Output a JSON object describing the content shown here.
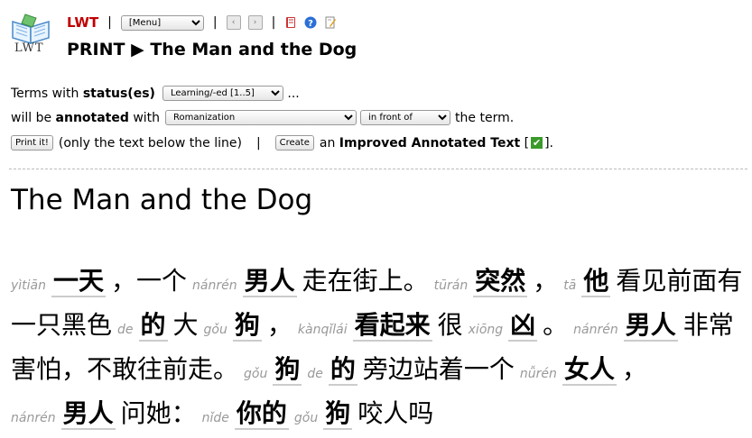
{
  "header": {
    "app_name": "LWT",
    "logo_text": "LWT",
    "menu_select": "[Menu]",
    "separator": "|",
    "page_title": "PRINT ▶ The Man and the Dog"
  },
  "options": {
    "line1_prefix": "Terms with ",
    "line1_bold": "status(es)",
    "status_select": "Learning/-ed [1..5]",
    "line1_suffix": " ...",
    "line2_prefix": "will be ",
    "line2_bold": "annotated",
    "line2_mid": " with",
    "annotation_select": "Romanization",
    "position_select": "in front of",
    "line2_suffix": "the term.",
    "print_button": "Print it!",
    "print_note": "(only the text below the line)",
    "sep": "|",
    "create_button": "Create",
    "improved_prefix": "an ",
    "improved_bold": "Improved Annotated Text",
    "improved_open": " [",
    "improved_close": "]."
  },
  "text": {
    "title": "The Man and the Dog",
    "segments": [
      {
        "rom": "yìtiān",
        "term": "一天"
      },
      {
        "plain": "，一个"
      },
      {
        "rom": "nánrén",
        "term": "男人"
      },
      {
        "plain": "走在街上。"
      },
      {
        "rom": "tūrán",
        "term": "突然"
      },
      {
        "plain": "，"
      },
      {
        "rom": "tā",
        "term": "他"
      },
      {
        "plain": "看见前面有一只黑色"
      },
      {
        "rom": "de",
        "term": "的"
      },
      {
        "plain": "大"
      },
      {
        "rom": "gǒu",
        "term": "狗"
      },
      {
        "plain": "，"
      },
      {
        "rom": "kànqǐlái",
        "term": "看起来"
      },
      {
        "plain": "很"
      },
      {
        "rom": "xiōng",
        "term": "凶"
      },
      {
        "plain": "。"
      },
      {
        "rom": "nánrén",
        "term": "男人"
      },
      {
        "plain": "非常害怕，不敢往前走。"
      },
      {
        "rom": "gǒu",
        "term": "狗"
      },
      {
        "rom": "de",
        "term": "的"
      },
      {
        "plain": "旁边站着一个"
      },
      {
        "rom": "nǚrén",
        "term": "女人"
      },
      {
        "plain": "，"
      },
      {
        "rom": "nánrén",
        "term": "男人"
      },
      {
        "plain": "问她："
      },
      {
        "rom": "nǐde",
        "term": "你的"
      },
      {
        "rom": "gǒu",
        "term": "狗"
      },
      {
        "plain": "咬人吗"
      }
    ]
  }
}
